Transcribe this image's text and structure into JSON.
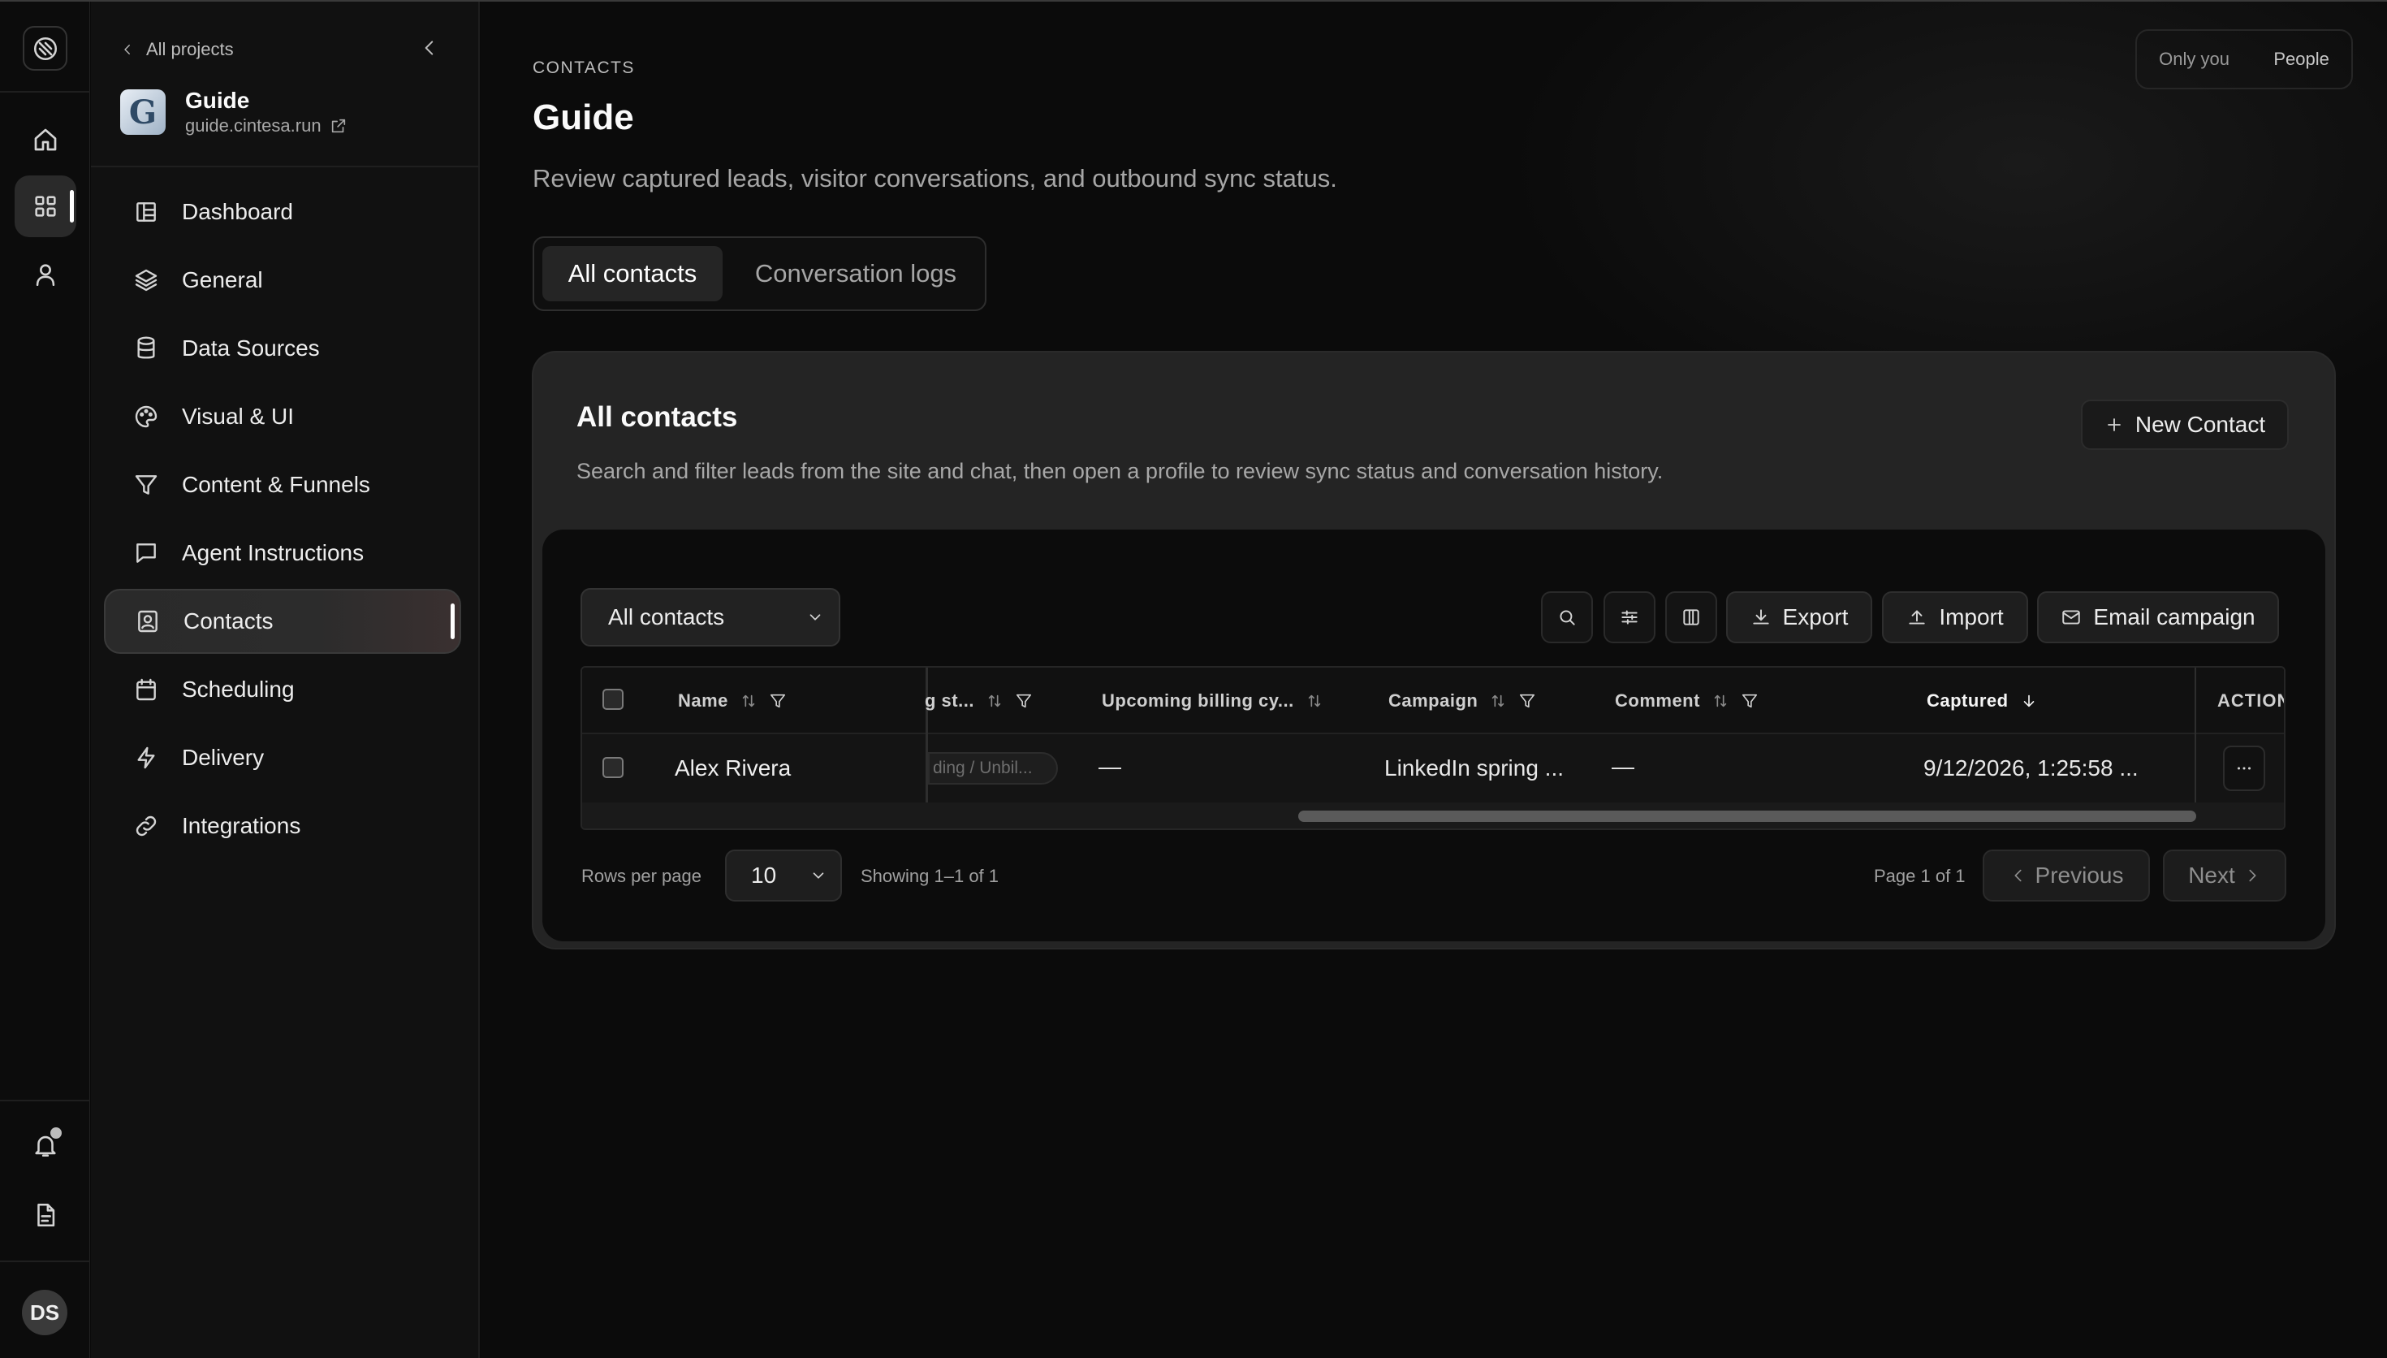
{
  "rail": {
    "avatar_initials": "DS"
  },
  "nav": {
    "back_link": "All projects",
    "project_name": "Guide",
    "project_url": "guide.cintesa.run",
    "items": [
      {
        "label": "Dashboard",
        "icon": "dashboard-icon"
      },
      {
        "label": "General",
        "icon": "layers-icon"
      },
      {
        "label": "Data Sources",
        "icon": "database-icon"
      },
      {
        "label": "Visual & UI",
        "icon": "palette-icon"
      },
      {
        "label": "Content & Funnels",
        "icon": "funnel-icon"
      },
      {
        "label": "Agent Instructions",
        "icon": "message-icon"
      },
      {
        "label": "Contacts",
        "icon": "contact-card-icon",
        "active": true
      },
      {
        "label": "Scheduling",
        "icon": "calendar-icon"
      },
      {
        "label": "Delivery",
        "icon": "lightning-icon"
      },
      {
        "label": "Integrations",
        "icon": "link-icon"
      }
    ]
  },
  "header": {
    "eyebrow": "CONTACTS",
    "title": "Guide",
    "subtitle": "Review captured leads, visitor conversations, and outbound sync status.",
    "visibility": {
      "only_you": "Only you",
      "people": "People"
    }
  },
  "tabs": [
    {
      "label": "All contacts",
      "active": true
    },
    {
      "label": "Conversation logs",
      "active": false
    }
  ],
  "card": {
    "title": "All contacts",
    "description": "Search and filter leads from the site and chat, then open a profile to review sync status and conversation history.",
    "new_button": "New Contact"
  },
  "toolbar": {
    "filter_select": "All contacts",
    "export": "Export",
    "import": "Import",
    "email_campaign": "Email campaign"
  },
  "table": {
    "columns": {
      "name": "Name",
      "status": "g st...",
      "billing": "Upcoming billing cy...",
      "campaign": "Campaign",
      "comment": "Comment",
      "captured": "Captured",
      "actions": "ACTION"
    },
    "rows": [
      {
        "name": "Alex Rivera",
        "status": "ding / Unbil...",
        "billing": "—",
        "campaign": "LinkedIn spring ...",
        "comment": "—",
        "captured": "9/12/2026, 1:25:58 ..."
      }
    ]
  },
  "pagination": {
    "rows_per_page_label": "Rows per page",
    "rows_per_page": "10",
    "showing": "Showing 1–1 of 1",
    "page": "Page 1 of 1",
    "previous": "Previous",
    "next": "Next"
  }
}
